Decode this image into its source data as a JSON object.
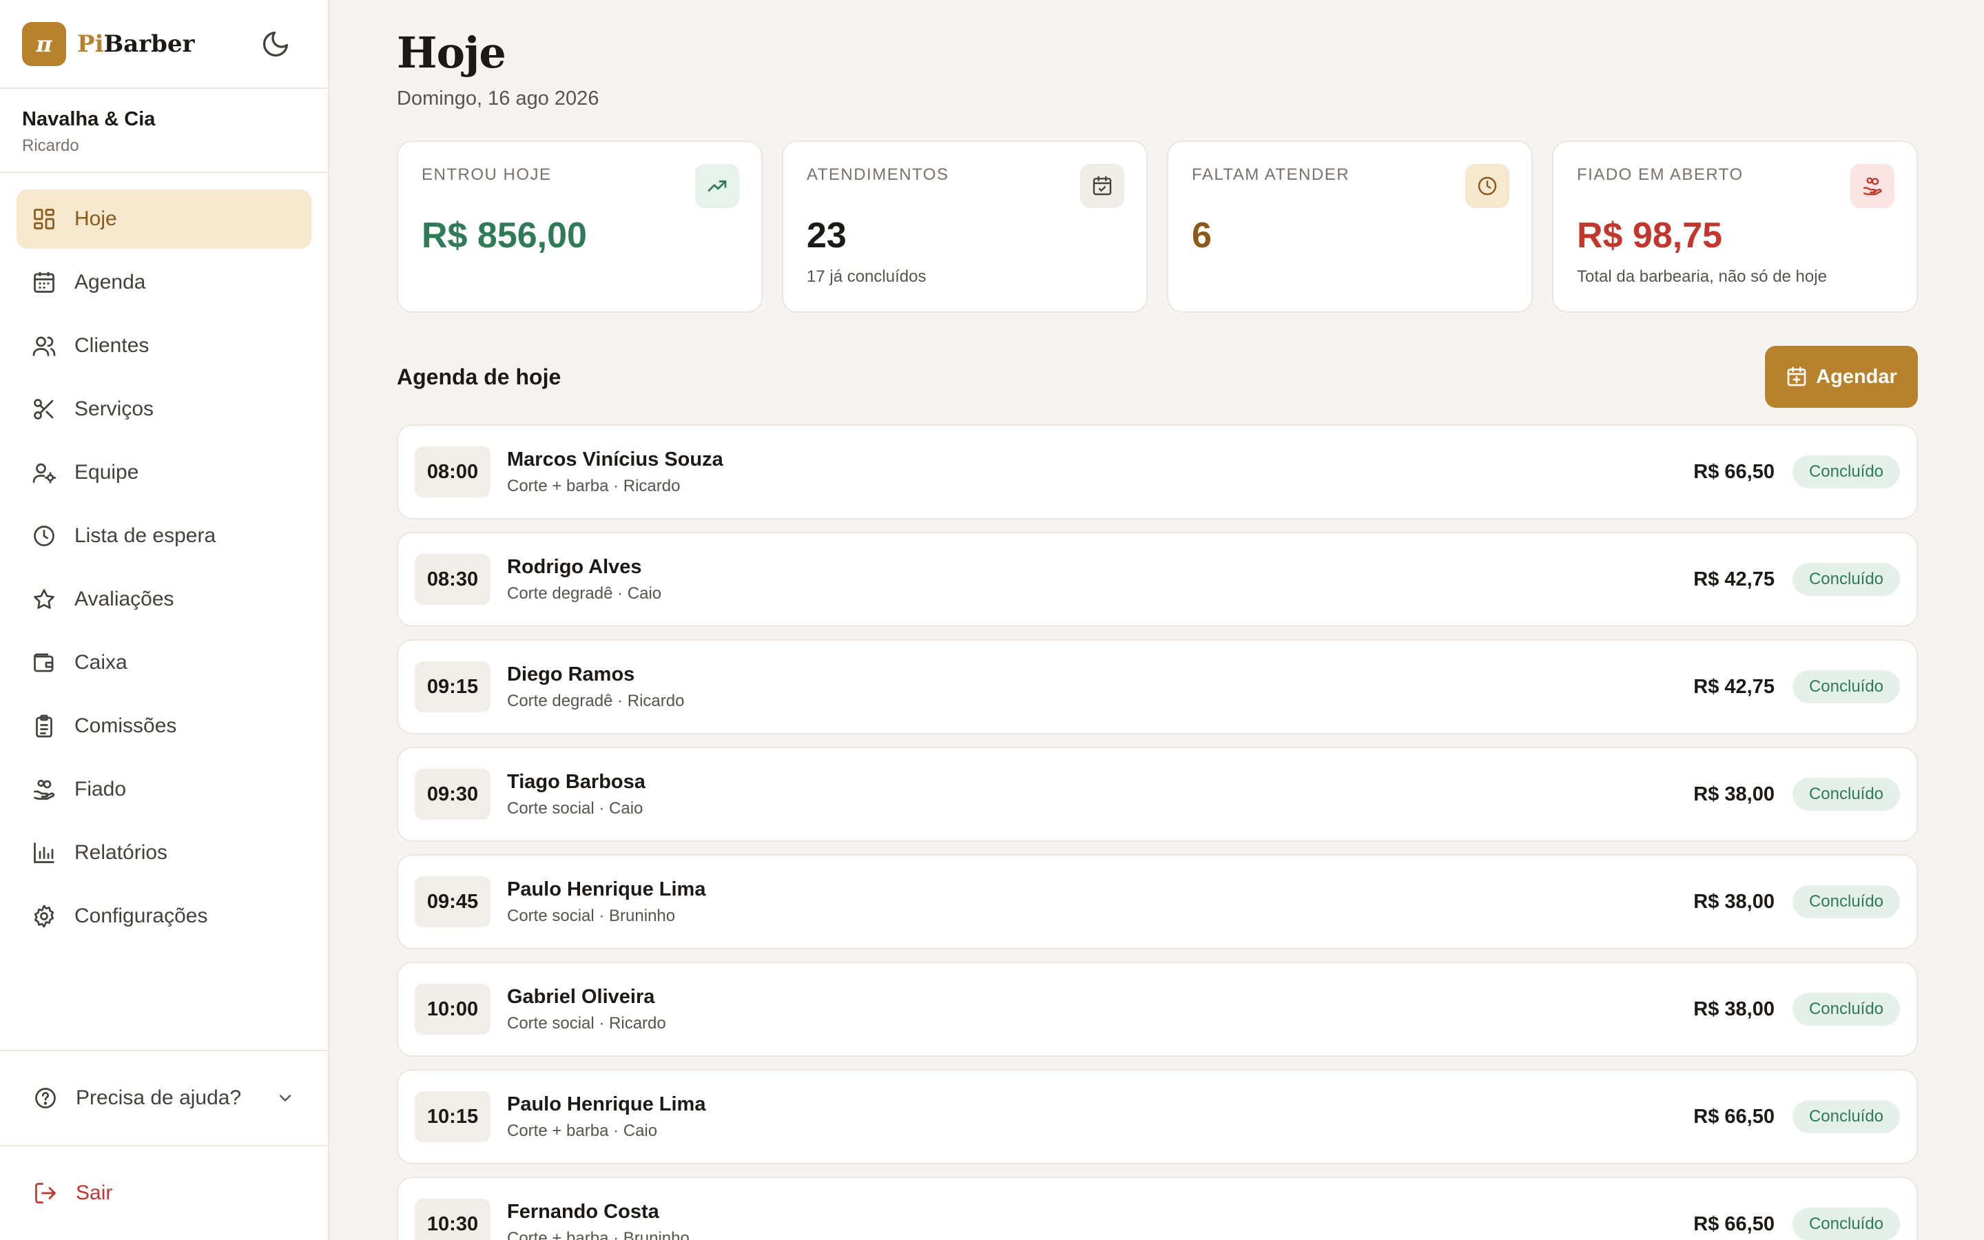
{
  "sidebar": {
    "brand_prefix": "Pi",
    "brand_suffix": "Barber",
    "logo_glyph": "π",
    "shop_name": "Navalha & Cia",
    "user_name": "Ricardo",
    "items": [
      {
        "label": "Hoje",
        "icon": "dashboard-icon",
        "active": true
      },
      {
        "label": "Agenda",
        "icon": "calendar-icon"
      },
      {
        "label": "Clientes",
        "icon": "users-icon"
      },
      {
        "label": "Serviços",
        "icon": "scissors-icon"
      },
      {
        "label": "Equipe",
        "icon": "user-cog-icon"
      },
      {
        "label": "Lista de espera",
        "icon": "clock-icon"
      },
      {
        "label": "Avaliações",
        "icon": "star-icon"
      },
      {
        "label": "Caixa",
        "icon": "wallet-icon"
      },
      {
        "label": "Comissões",
        "icon": "clipboard-icon"
      },
      {
        "label": "Fiado",
        "icon": "hand-coins-icon"
      },
      {
        "label": "Relatórios",
        "icon": "bar-chart-icon"
      },
      {
        "label": "Configurações",
        "icon": "gear-icon"
      }
    ],
    "help_label": "Precisa de ajuda?",
    "logout_label": "Sair"
  },
  "page": {
    "title": "Hoje",
    "date": "Domingo, 16 ago 2026"
  },
  "stats": [
    {
      "label": "ENTROU HOJE",
      "value": "R$ 856,00",
      "sub": "",
      "color": "#2f7a57",
      "icon_bg": "#e6f2ec",
      "icon": "trending-up-icon"
    },
    {
      "label": "ATENDIMENTOS",
      "value": "23",
      "sub": "17 já concluídos",
      "color": "#1c1917",
      "icon_bg": "#f0ece7",
      "icon": "calendar-check-icon"
    },
    {
      "label": "FALTAM ATENDER",
      "value": "6",
      "sub": "",
      "color": "#8a5a1a",
      "icon_bg": "#f6e7cf",
      "icon": "clock-icon"
    },
    {
      "label": "FIADO EM ABERTO",
      "value": "R$ 98,75",
      "sub": "Total da barbearia, não só de hoje",
      "color": "#c2372d",
      "icon_bg": "#fbe5e3",
      "icon": "hand-coins-icon"
    }
  ],
  "agenda": {
    "title": "Agenda de hoje",
    "button_label": "Agendar",
    "appointments": [
      {
        "time": "08:00",
        "name": "Marcos Vinícius Souza",
        "desc": "Corte + barba · Ricardo",
        "price": "R$ 66,50",
        "status": "Concluído"
      },
      {
        "time": "08:30",
        "name": "Rodrigo Alves",
        "desc": "Corte degradê · Caio",
        "price": "R$ 42,75",
        "status": "Concluído"
      },
      {
        "time": "09:15",
        "name": "Diego Ramos",
        "desc": "Corte degradê · Ricardo",
        "price": "R$ 42,75",
        "status": "Concluído"
      },
      {
        "time": "09:30",
        "name": "Tiago Barbosa",
        "desc": "Corte social · Caio",
        "price": "R$ 38,00",
        "status": "Concluído"
      },
      {
        "time": "09:45",
        "name": "Paulo Henrique Lima",
        "desc": "Corte social · Bruninho",
        "price": "R$ 38,00",
        "status": "Concluído"
      },
      {
        "time": "10:00",
        "name": "Gabriel Oliveira",
        "desc": "Corte social · Ricardo",
        "price": "R$ 38,00",
        "status": "Concluído"
      },
      {
        "time": "10:15",
        "name": "Paulo Henrique Lima",
        "desc": "Corte + barba · Caio",
        "price": "R$ 66,50",
        "status": "Concluído"
      },
      {
        "time": "10:30",
        "name": "Fernando Costa",
        "desc": "Corte + barba · Bruninho",
        "price": "R$ 66,50",
        "status": "Concluído"
      }
    ]
  }
}
